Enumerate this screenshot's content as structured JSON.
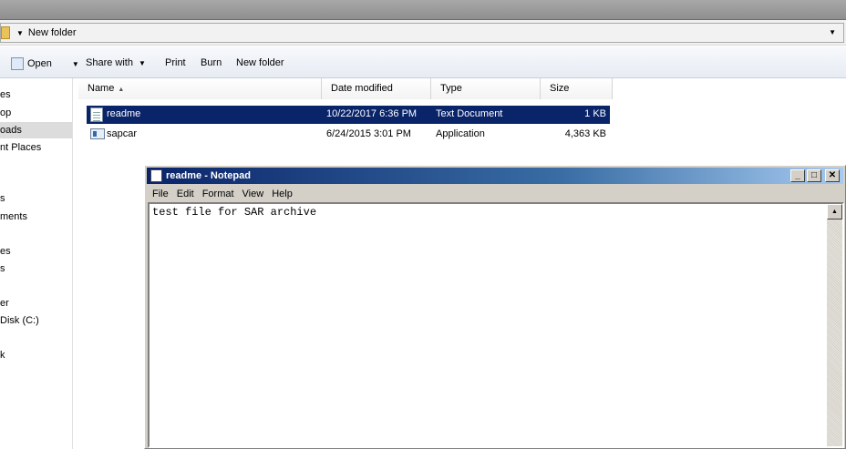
{
  "address": {
    "path": "New folder"
  },
  "toolbar": {
    "open": "Open",
    "share": "Share with",
    "print": "Print",
    "burn": "Burn",
    "new_folder": "New folder"
  },
  "nav": [
    {
      "label": "es"
    },
    {
      "label": "op"
    },
    {
      "label": "oads"
    },
    {
      "label": "nt Places"
    },
    {
      "label": "s"
    },
    {
      "label": "ments"
    },
    {
      "label": "es"
    },
    {
      "label": "s"
    },
    {
      "label": "er"
    },
    {
      "label": "Disk (C:)"
    },
    {
      "label": "k"
    }
  ],
  "columns": {
    "name": "Name",
    "date": "Date modified",
    "type": "Type",
    "size": "Size"
  },
  "files": [
    {
      "name": "readme",
      "date": "10/22/2017 6:36 PM",
      "type": "Text Document",
      "size": "1 KB"
    },
    {
      "name": "sapcar",
      "date": "6/24/2015 3:01 PM",
      "type": "Application",
      "size": "4,363 KB"
    }
  ],
  "notepad": {
    "title": "readme - Notepad",
    "menu": [
      "File",
      "Edit",
      "Format",
      "View",
      "Help"
    ],
    "content": "test file for SAR archive"
  }
}
